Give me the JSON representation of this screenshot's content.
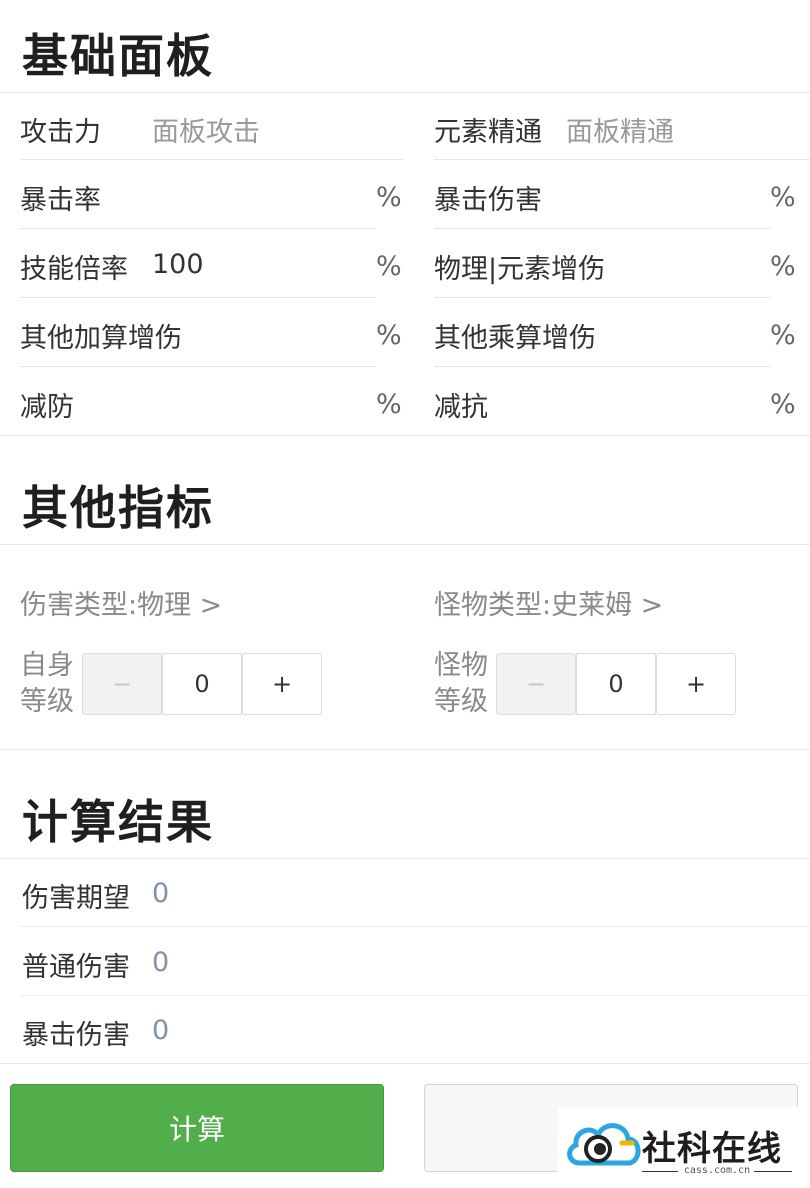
{
  "sections": {
    "panel_title": "基础面板",
    "other_title": "其他指标",
    "result_title": "计算结果"
  },
  "panel": {
    "attack_label": "攻击力",
    "attack_placeholder": "面板攻击",
    "em_label": "元素精通",
    "em_placeholder": "面板精通",
    "crit_rate_label": "暴击率",
    "crit_dmg_label": "暴击伤害",
    "skill_mult_label": "技能倍率",
    "skill_mult_value": "100",
    "phys_elem_bonus_label": "物理|元素增伤",
    "other_add_bonus_label": "其他加算增伤",
    "other_mult_bonus_label": "其他乘算增伤",
    "def_reduction_label": "减防",
    "res_reduction_label": "减抗",
    "percent": "%"
  },
  "other": {
    "damage_type": "伤害类型:物理 >",
    "monster_type": "怪物类型:史莱姆 >",
    "self_level_label": "自身等级",
    "monster_level_label": "怪物等级",
    "self_level_value": "0",
    "monster_level_value": "0",
    "minus": "−",
    "plus": "+"
  },
  "results": {
    "expected_label": "伤害期望",
    "expected_value": "0",
    "normal_label": "普通伤害",
    "normal_value": "0",
    "crit_label": "暴击伤害",
    "crit_value": "0"
  },
  "buttons": {
    "calculate": "计算",
    "reset": ""
  },
  "watermark": {
    "text": "社科在线",
    "domain": "cass.com.cn"
  },
  "colors": {
    "primary": "#52ad4b",
    "result_value": "#8391a8",
    "placeholder": "#9a9a9a"
  }
}
